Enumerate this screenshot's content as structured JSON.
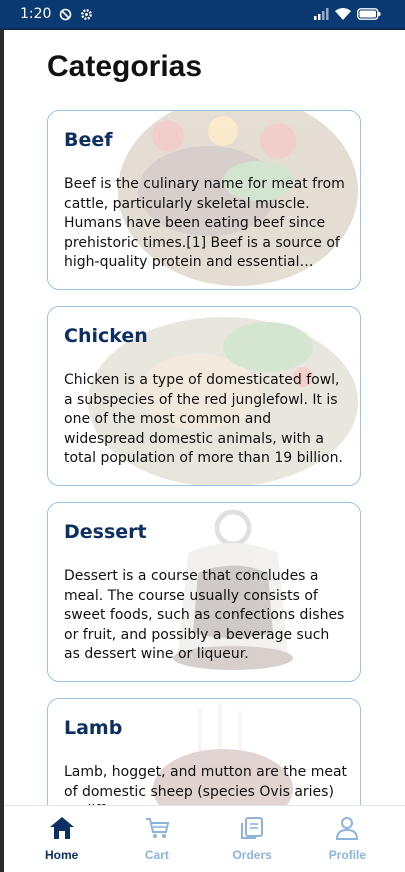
{
  "status_bar": {
    "time": "1:20",
    "icons": [
      "dnd-icon",
      "settings-gear-icon",
      "signal-icon",
      "wifi-icon",
      "battery-icon"
    ]
  },
  "page": {
    "title": "Categorias"
  },
  "categories": [
    {
      "name": "Beef",
      "description": "Beef is the culinary name for meat from cattle, particularly skeletal muscle. Humans have been eating beef since prehistoric times.[1] Beef is a source of high-quality protein and essential nutrients.",
      "image": "beef-salad-image"
    },
    {
      "name": "Chicken",
      "description": "Chicken is a type of domesticated fowl, a subspecies of the red junglefowl. It is one of the most common and widespread domestic animals, with a total population of more than 19 billion.",
      "image": "roast-chicken-image"
    },
    {
      "name": "Dessert",
      "description": "Dessert is a course that concludes a meal. The course usually consists of sweet foods, such as confections dishes or fruit, and possibly a beverage such as dessert wine or liqueur.",
      "image": "chocolate-dessert-image"
    },
    {
      "name": "Lamb",
      "description": "Lamb, hogget, and mutton are the meat of domestic sheep (species Ovis aries) at different ages.",
      "image": "lamb-chops-image"
    }
  ],
  "bottom_nav": {
    "items": [
      {
        "label": "Home",
        "icon": "home-icon",
        "active": true
      },
      {
        "label": "Cart",
        "icon": "cart-icon",
        "active": false
      },
      {
        "label": "Orders",
        "icon": "orders-icon",
        "active": false
      },
      {
        "label": "Profile",
        "icon": "profile-icon",
        "active": false
      }
    ]
  },
  "colors": {
    "status_bar_bg": "#0b3a73",
    "accent": "#0d2f63",
    "inactive_nav": "#8fb4dc",
    "card_border": "#9cc3e4"
  }
}
